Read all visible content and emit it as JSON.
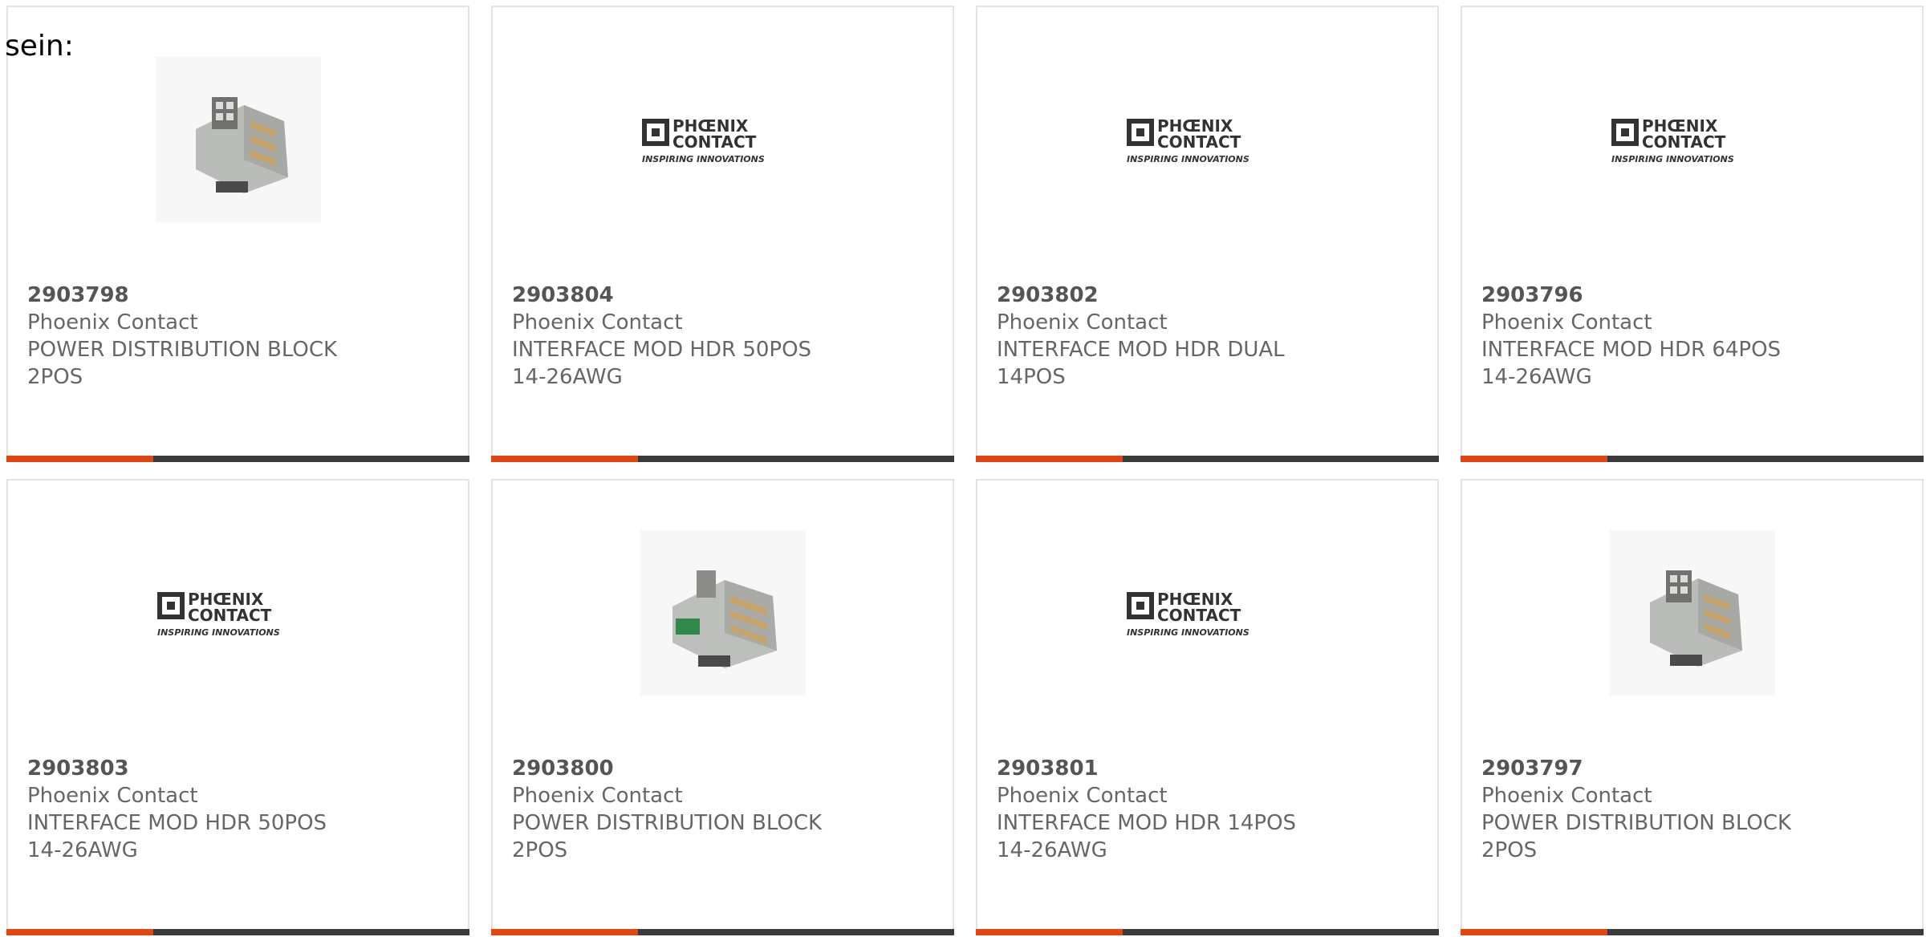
{
  "intro_text": "sein:",
  "products": [
    {
      "part": "2903798",
      "maker": "Phoenix Contact",
      "desc": "POWER DISTRIBUTION BLOCK 2POS",
      "image": "product-photo"
    },
    {
      "part": "2903804",
      "maker": "Phoenix Contact",
      "desc": "INTERFACE MOD HDR 50POS 14-26AWG",
      "image": "phoenix-logo"
    },
    {
      "part": "2903802",
      "maker": "Phoenix Contact",
      "desc": "INTERFACE MOD HDR DUAL 14POS",
      "image": "phoenix-logo"
    },
    {
      "part": "2903796",
      "maker": "Phoenix Contact",
      "desc": "INTERFACE MOD HDR 64POS 14-26AWG",
      "image": "phoenix-logo"
    },
    {
      "part": "2903803",
      "maker": "Phoenix Contact",
      "desc": "INTERFACE MOD HDR 50POS 14-26AWG",
      "image": "phoenix-logo"
    },
    {
      "part": "2903800",
      "maker": "Phoenix Contact",
      "desc": "POWER DISTRIBUTION BLOCK 2POS",
      "image": "product-photo-green"
    },
    {
      "part": "2903801",
      "maker": "Phoenix Contact",
      "desc": "INTERFACE MOD HDR 14POS 14-26AWG",
      "image": "phoenix-logo"
    },
    {
      "part": "2903797",
      "maker": "Phoenix Contact",
      "desc": "POWER DISTRIBUTION BLOCK 2POS",
      "image": "product-photo"
    }
  ],
  "logo": {
    "line1": "PHŒNIX",
    "line2": "CONTACT",
    "tagline": "INSPIRING INNOVATIONS"
  },
  "colors": {
    "accent": "#e2450f",
    "bar": "#3b3b3b",
    "border": "#e3e3e3",
    "text": "#666666"
  }
}
